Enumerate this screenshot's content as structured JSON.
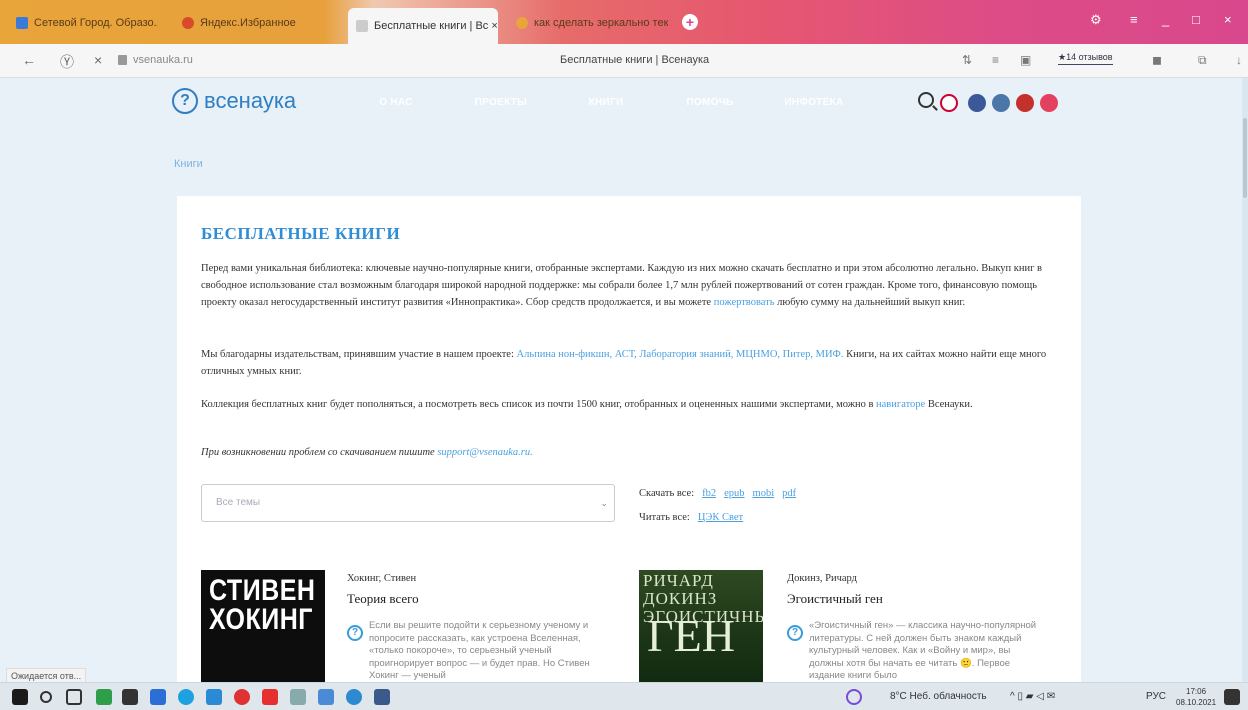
{
  "browser": {
    "tabs": [
      {
        "label": "Сетевой Город. Образо...",
        "color": "#3b7ad6"
      },
      {
        "label": "Яндекс.Избранное",
        "color": "#d84b2a"
      },
      {
        "label": "Бесплатные книги | Вс ×",
        "color": "#cccccc"
      },
      {
        "label": "как сделать зеркально тек",
        "color": "#e8a53a"
      }
    ],
    "new_tab": "+",
    "window_controls": [
      "⚙",
      "≡",
      "_",
      "□",
      "×"
    ],
    "url": "vsenauka.ru",
    "page_title": "Бесплатные книги | Всенаука",
    "reviews": "★14 отзывов"
  },
  "site": {
    "logo_text": "всенаука",
    "logo_mark": "?",
    "nav": [
      {
        "label": "О НАС",
        "color": "#ee3b3b"
      },
      {
        "label": "ПРОЕКТЫ",
        "color": "#8e6ad8"
      },
      {
        "label": "КНИГИ",
        "color": "#f7901e"
      },
      {
        "label": "ПОМОЧЬ",
        "color": "#2f86e0"
      },
      {
        "label": "ИНФОТЕКА",
        "color": "#1fb84a"
      }
    ],
    "breadcrumb": "Книги"
  },
  "content": {
    "heading": "БЕСПЛАТНЫЕ КНИГИ",
    "p1_a": "Перед вами уникальная библиотека: ключевые научно-популярные книги, отобранные экспертами. Каждую из них можно скачать бесплатно и при этом абсолютно легально. Выкуп книг в свободное использование стал возможным благодаря широкой народной поддержке: мы собрали более 1,7 млн рублей пожертвований от сотен граждан. Кроме того, финансовую помощь проекту оказал негосударственный институт развития «Иннопрактика». Сбор средств продолжается, и вы можете ",
    "p1_link": "пожертвовать",
    "p1_b": " любую сумму на дальнейший выкуп книг.",
    "p2_a": "Мы благодарны издательствам, принявшим участие в нашем проекте: ",
    "p2_link": "Альпина нон-фикшн, АСТ, Лаборатория знаний, МЦНМО, Питер, МИФ.",
    "p2_b": " Книги, на их сайтах можно найти еще много отличных умных книг.",
    "p3_a": "Коллекция бесплатных книг будет пополняться, а посмотреть весь список из почти 1500 книг, отобранных и оцененных нашими экспертами, можно в ",
    "p3_link": "навигаторе",
    "p3_b": " Всенауки.",
    "p4_a": "При возникновении проблем со скачиванием пишите ",
    "p4_link": "support@vsenauka.ru.",
    "select_placeholder": "Все темы",
    "download_all_label": "Скачать все:",
    "download_formats": [
      "fb2",
      "epub",
      "mobi",
      "pdf"
    ],
    "read_all_label": "Читать все:",
    "read_all_link": "ЦЭК Свет"
  },
  "books": [
    {
      "cover_text": "СТИВЕН ХОКИНГ",
      "author": "Хокинг, Стивен",
      "title": "Теория всего",
      "desc": "Если вы решите подойти к серьезному ученому и попросите рассказать, как устроена Вселенная, «только покороче», то серьезный ученый проигнорирует вопрос — и будет прав. Но Стивен Хокинг — ученый"
    },
    {
      "cover_text_top": "РИЧАРД ДОКИНЗ ЭГОИСТИЧНЫЙ",
      "cover_text_big": "ГЕН",
      "author": "Докинз, Ричард",
      "title": "Эгоистичный ген",
      "desc": "«Эгоистичный ген» — классика научно-популярной литературы. С ней должен быть знаком каждый культурный человек. Как и «Войну и мир», вы должны хотя бы начать ее читать 🙂. Первое издание книги было"
    }
  ],
  "status_text": "Ожидается отв...",
  "taskbar": {
    "weather": "8°C Неб. облачность",
    "lang": "РУС",
    "time": "17:06",
    "date": "08.10.2021"
  }
}
